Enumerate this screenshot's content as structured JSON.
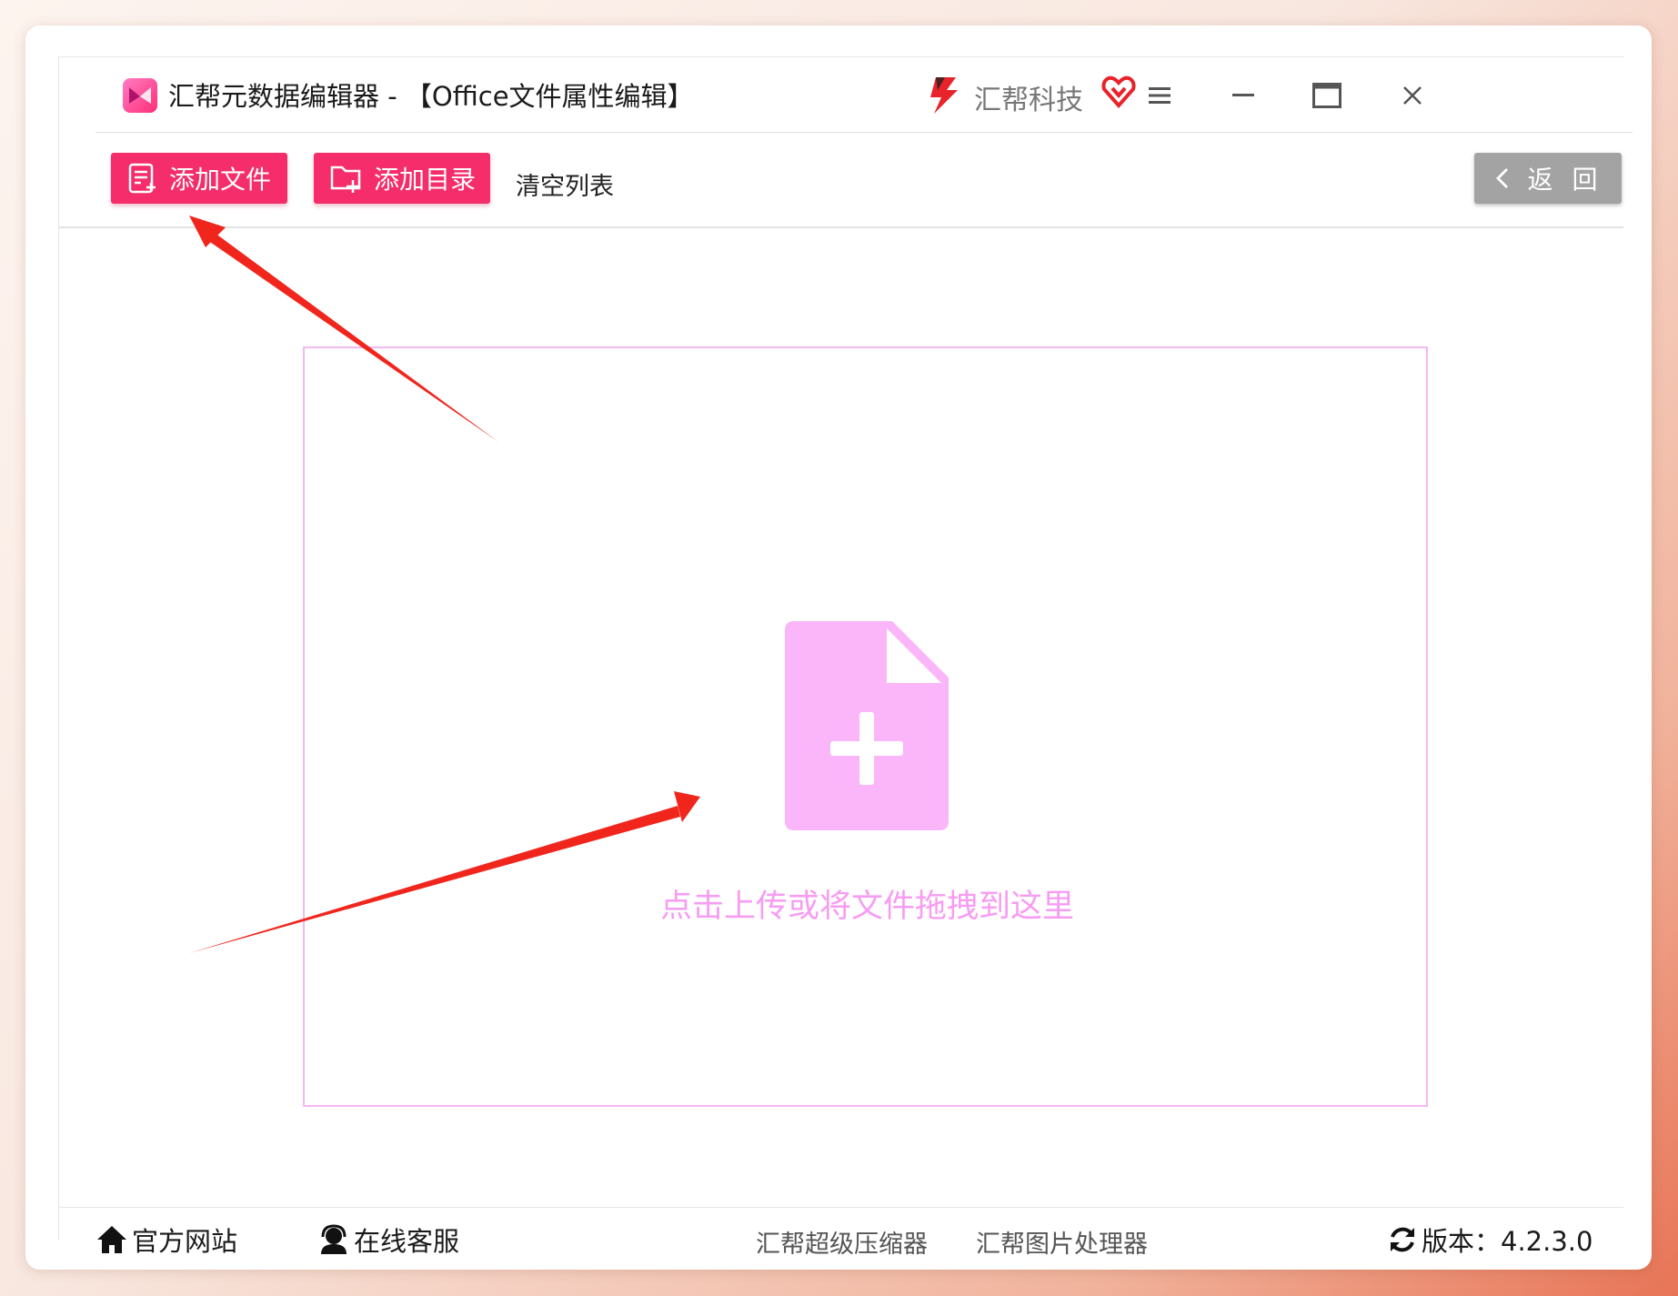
{
  "window": {
    "title": "汇帮元数据编辑器 - 【Office文件属性编辑】",
    "brand": "汇帮科技"
  },
  "toolbar": {
    "add_file_label": "添加文件",
    "add_folder_label": "添加目录",
    "clear_list_label": "清空列表",
    "back_label": "返 回"
  },
  "dropzone": {
    "prompt": "点击上传或将文件拖拽到这里"
  },
  "footer": {
    "website_label": "官方网站",
    "support_label": "在线客服",
    "compressor_link": "汇帮超级压缩器",
    "image_tool_link": "汇帮图片处理器",
    "version_label": "版本：4.2.3.0"
  },
  "colors": {
    "accent": "#f52d6a",
    "drop_icon": "#fbb6f9",
    "drop_text": "#f79cf3",
    "back_button": "#a3a3a3",
    "annotation_arrow": "#f0261d"
  },
  "icons": [
    "app-logo-icon",
    "brand-logo-icon",
    "vip-heart-icon",
    "menu-icon",
    "minimize-icon",
    "maximize-icon",
    "close-icon",
    "add-file-icon",
    "add-folder-icon",
    "chevron-left-icon",
    "file-plus-icon",
    "home-icon",
    "support-icon",
    "refresh-icon"
  ]
}
